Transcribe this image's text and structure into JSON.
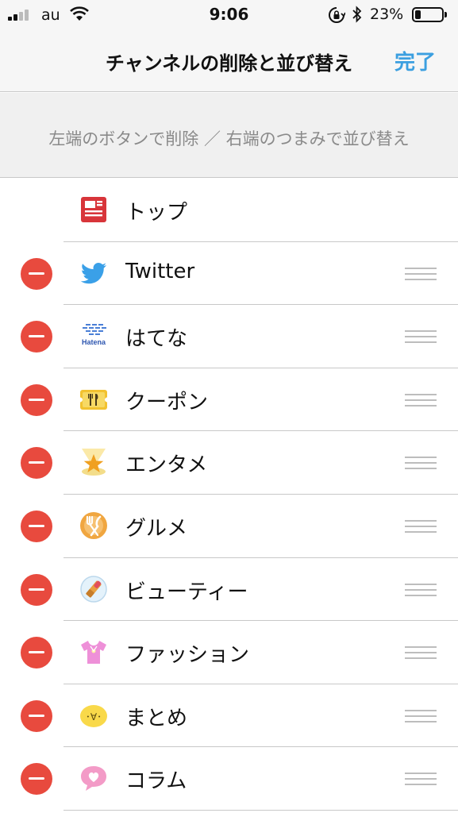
{
  "status": {
    "carrier": "au",
    "time": "9:06",
    "battery": "23%",
    "battery_level": 0.23
  },
  "nav": {
    "title": "チャンネルの削除と並び替え",
    "done": "完了"
  },
  "hint": "左端のボタンで削除 ／ 右端のつまみで並び替え",
  "channels": [
    {
      "label": "トップ",
      "icon": "newspaper-icon",
      "deletable": false
    },
    {
      "label": "Twitter",
      "icon": "twitter-bird-icon",
      "deletable": true
    },
    {
      "label": "はてな",
      "icon": "hatena-logo-icon",
      "icon_text": "Hatena",
      "deletable": true
    },
    {
      "label": "クーポン",
      "icon": "coupon-ticket-icon",
      "deletable": true
    },
    {
      "label": "エンタメ",
      "icon": "star-spotlight-icon",
      "deletable": true
    },
    {
      "label": "グルメ",
      "icon": "fork-knife-plate-icon",
      "deletable": true
    },
    {
      "label": "ビューティー",
      "icon": "lipstick-icon",
      "deletable": true
    },
    {
      "label": "ファッション",
      "icon": "tshirt-icon",
      "deletable": true
    },
    {
      "label": "まとめ",
      "icon": "smiley-face-icon",
      "icon_text": "･∀･",
      "deletable": true
    },
    {
      "label": "コラム",
      "icon": "heart-bubble-icon",
      "deletable": true
    }
  ],
  "colors": {
    "accent": "#3b9fe0",
    "delete": "#e84a3e",
    "hint_text": "#8a8a8a",
    "divider": "#c8c8c8"
  }
}
